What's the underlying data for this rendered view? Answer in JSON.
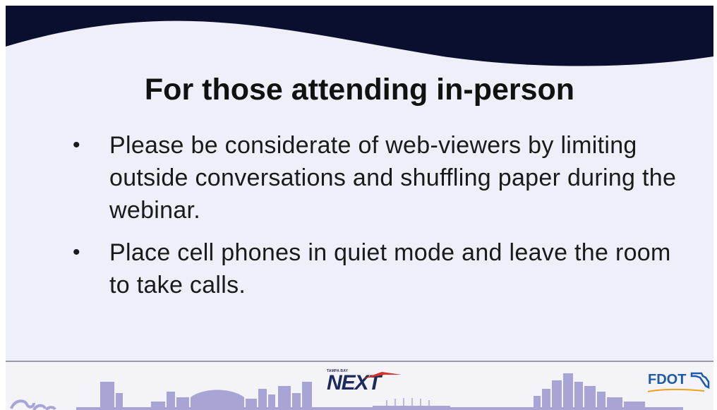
{
  "slide": {
    "title": "For those attending in-person",
    "bullets": [
      {
        "marker": "•",
        "text": "Please be considerate of web-viewers by limiting outside conversations and shuffling paper during the webinar."
      },
      {
        "marker": "•",
        "text": "Place cell phones in quiet mode and leave the room to take calls."
      }
    ]
  },
  "footer": {
    "next_logo": {
      "top_text": "TAMPA BAY",
      "word": "NEXT"
    },
    "fdot_logo": {
      "word": "FDOT"
    },
    "skyline_icon": "city-skyline-icon"
  },
  "colors": {
    "background": "#eeeff8",
    "header_wave": "#0b0f2e",
    "skyline": "#a9a4d6",
    "text": "#111111",
    "next_logo": "#1d2a5c",
    "fdot_logo": "#1e5aa8"
  }
}
